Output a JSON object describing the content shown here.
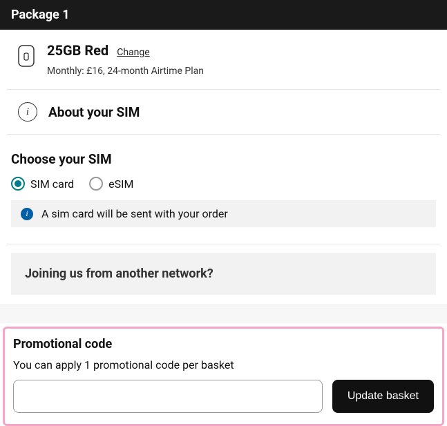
{
  "header": {
    "title": "Package 1"
  },
  "plan": {
    "title": "25GB Red",
    "change_label": "Change",
    "subtitle": "Monthly: £16, 24-month Airtime Plan"
  },
  "about": {
    "title": "About your SIM"
  },
  "choose": {
    "title": "Choose your SIM",
    "options": [
      {
        "label": "SIM card",
        "selected": true
      },
      {
        "label": "eSIM",
        "selected": false
      }
    ],
    "info_text": "A sim card will be sent with your order"
  },
  "joining": {
    "title": "Joining us from another network?"
  },
  "promo": {
    "title": "Promotional code",
    "subtitle": "You can apply 1 promotional code per basket",
    "input_value": "",
    "button_label": "Update basket"
  }
}
